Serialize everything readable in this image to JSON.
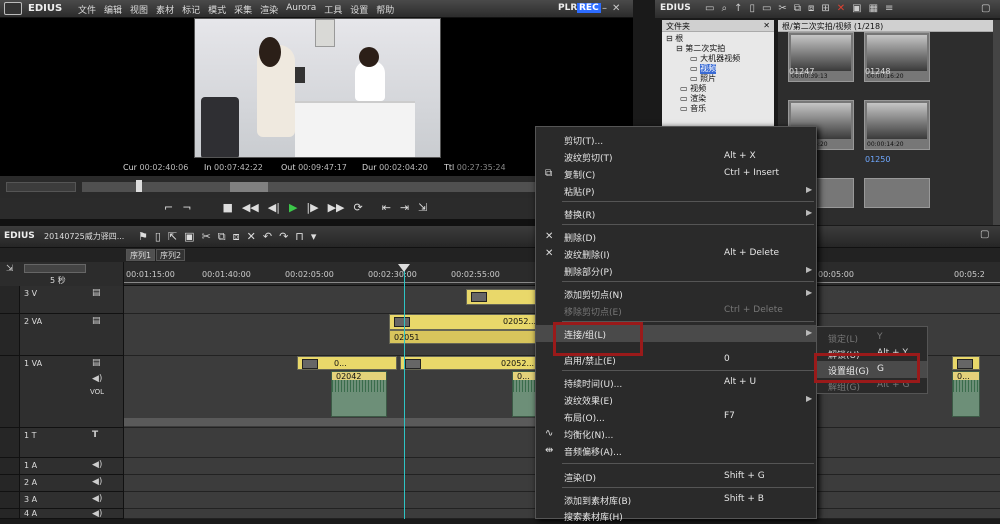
{
  "app": {
    "name": "EDIUS",
    "menus": [
      "文件",
      "编辑",
      "视图",
      "素材",
      "标记",
      "模式",
      "采集",
      "渲染",
      "Aurora",
      "工具",
      "设置",
      "帮助"
    ],
    "plr": "PLR",
    "rec": "REC"
  },
  "player": {
    "timecodes": [
      {
        "label": "Cur",
        "value": "00:02:40:06"
      },
      {
        "label": "In",
        "value": "00:07:42:22"
      },
      {
        "label": "Out",
        "value": "00:09:47:17"
      },
      {
        "label": "Dur",
        "value": "00:02:04:20"
      },
      {
        "label": "Ttl",
        "value": "00:27:35:24"
      }
    ]
  },
  "bin": {
    "title": "EDIUS",
    "folder_header": "文件夹",
    "tree": [
      "根",
      "第二次实拍",
      "大机器视频",
      "视频",
      "照片",
      "视频",
      "渲染",
      "音乐"
    ],
    "path": "根/第二次实拍/视频 (1/218)",
    "clips": [
      "01247",
      "01248",
      "01250"
    ],
    "clip_timecodes": [
      "00:00:00:00",
      "00:00:39:13",
      "00:00:00:00",
      "00:00:16:20",
      "00:00:00:00",
      "00:00:14:20",
      "00:00:00:00",
      "00:00:14:20"
    ]
  },
  "timeline": {
    "app": "EDIUS",
    "project": "20140725威力驿四...",
    "sequences": [
      "序列1",
      "序列2"
    ],
    "zoom": "5 秒",
    "ruler": [
      "00:01:15:00",
      "00:01:40:00",
      "00:02:05:00",
      "00:02:30:00",
      "00:02:55:00",
      "00:05:00",
      "00:05:2"
    ],
    "tracks": [
      "3 V",
      "2 VA",
      "1 VA",
      "1 T",
      "1 A",
      "2 A",
      "3 A",
      "4 A"
    ],
    "vol": "VOL",
    "clip_labels": [
      "02052...",
      "02051",
      "0...",
      "02052...",
      "02042",
      "TL",
      "0...",
      "02..",
      "TL",
      "0..."
    ]
  },
  "context_menu": {
    "items": [
      {
        "label": "剪切(T)...",
        "shortcut": ""
      },
      {
        "label": "波纹剪切(T)",
        "shortcut": "Alt + X"
      },
      {
        "label": "复制(C)",
        "shortcut": "Ctrl + Insert"
      },
      {
        "label": "粘贴(P)",
        "shortcut": ""
      },
      {
        "label": "替换(R)",
        "shortcut": ""
      },
      {
        "label": "删除(D)",
        "shortcut": ""
      },
      {
        "label": "波纹删除(I)",
        "shortcut": "Alt + Delete"
      },
      {
        "label": "删除部分(P)",
        "shortcut": ""
      },
      {
        "label": "添加剪切点(N)",
        "shortcut": ""
      },
      {
        "label": "移除剪切点(E)",
        "shortcut": "Ctrl + Delete"
      },
      {
        "label": "连接/组(L)",
        "shortcut": ""
      },
      {
        "label": "启用/禁止(E)",
        "shortcut": "0"
      },
      {
        "label": "持续时间(U)...",
        "shortcut": "Alt + U"
      },
      {
        "label": "波纹效果(E)",
        "shortcut": ""
      },
      {
        "label": "布局(O)...",
        "shortcut": "F7"
      },
      {
        "label": "均衡化(N)...",
        "shortcut": ""
      },
      {
        "label": "音频偏移(A)...",
        "shortcut": ""
      },
      {
        "label": "渲染(D)",
        "shortcut": "Shift + G"
      },
      {
        "label": "添加到素材库(B)",
        "shortcut": "Shift + B"
      },
      {
        "label": "搜索素材库(H)",
        "shortcut": ""
      }
    ],
    "submenu": [
      {
        "label": "锁定(L)",
        "shortcut": "Y"
      },
      {
        "label": "解锁(U)",
        "shortcut": "Alt + Y"
      },
      {
        "label": "设置组(G)",
        "shortcut": "G"
      },
      {
        "label": "解组(G)",
        "shortcut": "Alt + G"
      }
    ]
  }
}
